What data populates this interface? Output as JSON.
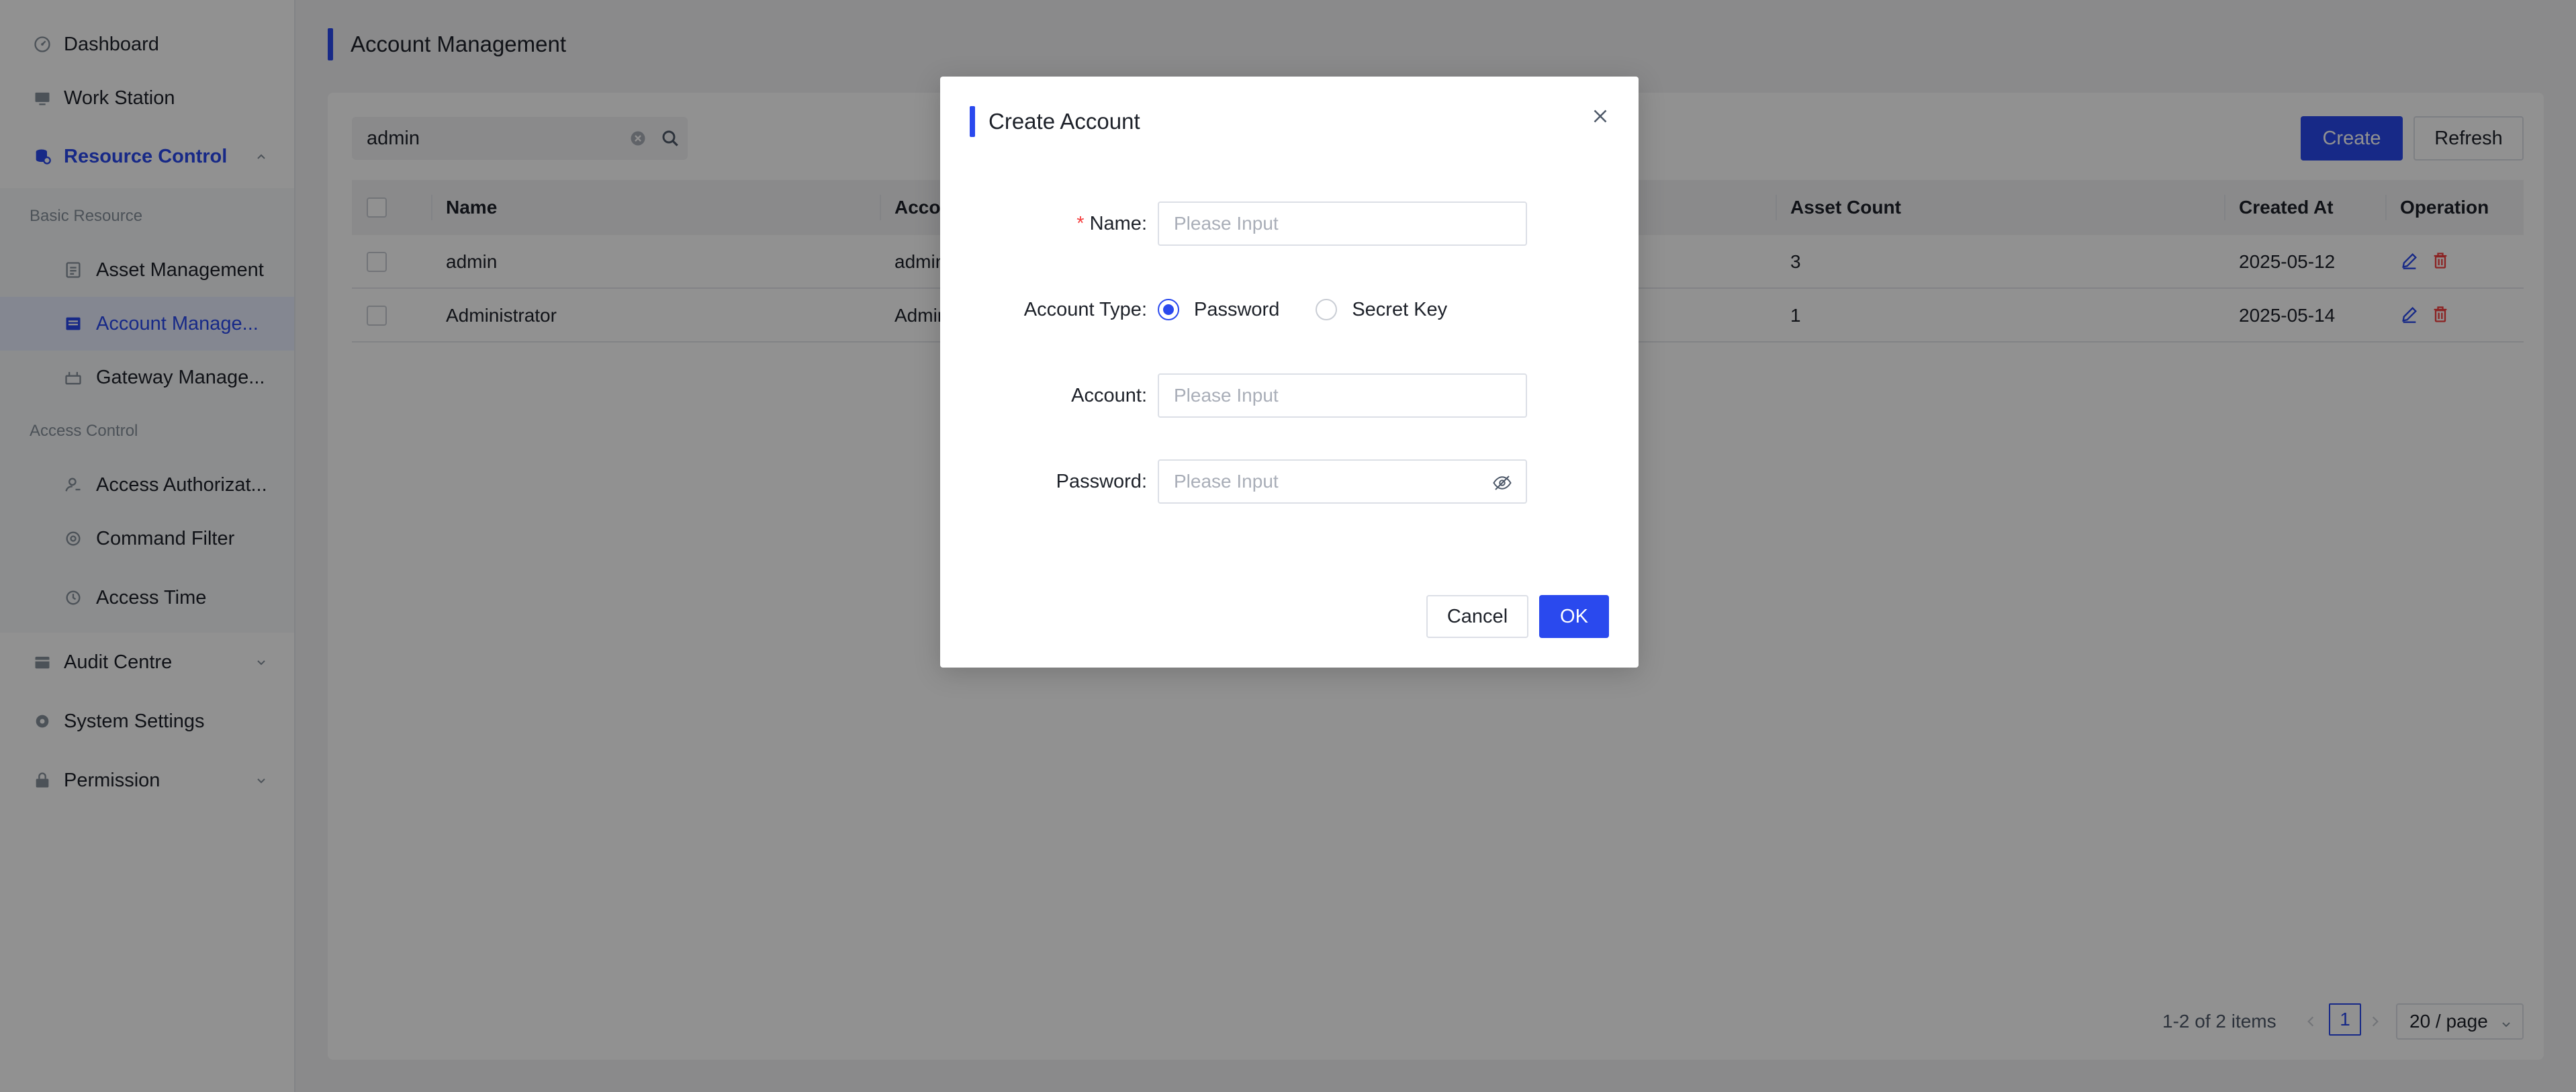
{
  "sidebar": {
    "items": [
      {
        "label": "Dashboard",
        "icon": "dashboard-icon"
      },
      {
        "label": "Work Station",
        "icon": "monitor-icon"
      },
      {
        "label": "Resource Control",
        "icon": "database-icon",
        "expanded": true
      },
      {
        "label": "Audit Centre",
        "icon": "calendar-icon"
      },
      {
        "label": "System Settings",
        "icon": "gear-icon"
      },
      {
        "label": "Permission",
        "icon": "lock-icon"
      }
    ],
    "groups": [
      {
        "label": "Basic Resource",
        "items": [
          {
            "label": "Asset Management",
            "icon": "document-icon"
          },
          {
            "label": "Account Manage...",
            "icon": "account-card-icon",
            "selected": true
          },
          {
            "label": "Gateway Manage...",
            "icon": "gateway-icon"
          }
        ]
      },
      {
        "label": "Access Control",
        "items": [
          {
            "label": "Access Authorizat...",
            "icon": "user-auth-icon"
          },
          {
            "label": "Command Filter",
            "icon": "filter-shield-icon"
          },
          {
            "label": "Access Time",
            "icon": "clock-icon"
          }
        ]
      }
    ]
  },
  "page": {
    "title": "Account Management"
  },
  "search": {
    "value": "admin"
  },
  "toolbar": {
    "create_label": "Create",
    "refresh_label": "Refresh"
  },
  "table": {
    "columns": [
      "Name",
      "Acco",
      "Asset Count",
      "Created At",
      "Operation"
    ],
    "rows": [
      {
        "name": "admin",
        "account": "admin",
        "asset_count": "3",
        "created_at": "2025-05-12"
      },
      {
        "name": "Administrator",
        "account": "Admin",
        "asset_count": "1",
        "created_at": "2025-05-14"
      }
    ]
  },
  "pagination": {
    "total": "1-2 of 2 items",
    "current": "1",
    "page_size": "20 / page"
  },
  "modal": {
    "title": "Create Account",
    "fields": {
      "name": {
        "label": "Name",
        "required_mark": "*",
        "placeholder": "Please Input"
      },
      "account_type": {
        "label": "Account Type",
        "options": [
          "Password",
          "Secret Key"
        ],
        "selected": "Password"
      },
      "account": {
        "label": "Account",
        "placeholder": "Please Input"
      },
      "password": {
        "label": "Password",
        "placeholder": "Please Input"
      }
    },
    "cancel_label": "Cancel",
    "ok_label": "OK"
  },
  "colors": {
    "primary": "#2a49ee",
    "danger": "#f53f3f",
    "overlay": "rgba(0,0,0,0.43)"
  }
}
